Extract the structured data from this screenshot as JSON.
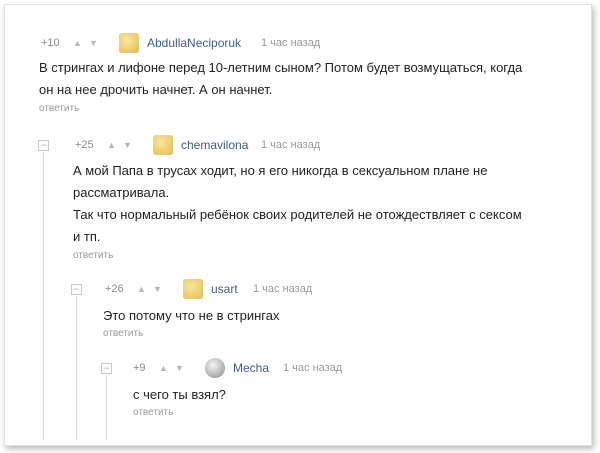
{
  "comments": [
    {
      "rating": "+10",
      "author": "AbdullaNeciporuk",
      "time": "1 час назад",
      "lines": [
        "В стрингах и лифоне перед 10-летним сыном? Потом будет возмущаться, когда",
        "он на нее дрочить начнет. А он начнет."
      ],
      "reply": "ответить"
    },
    {
      "rating": "+25",
      "author": "chemavilona",
      "time": "1 час назад",
      "lines": [
        "А мой Папа в трусах ходит, но я его никогда в сексуальном плане не",
        "рассматривала.",
        "Так что нормальный ребёнок своих родителей не отождествляет с сексом",
        "и тп."
      ],
      "reply": "ответить"
    },
    {
      "rating": "+26",
      "author": "usart",
      "time": "1 час назад",
      "lines": [
        "Это потому что не в стрингах"
      ],
      "reply": "ответить"
    },
    {
      "rating": "+9",
      "author": "Mecha",
      "time": "1 час назад",
      "lines": [
        "с чего ты взял?"
      ],
      "reply": "ответить"
    }
  ],
  "icons": {
    "upvote": "triangle-up-icon",
    "downvote": "triangle-down-icon",
    "collapse": "minus-box-icon"
  },
  "colors": {
    "author": "#3e5c88",
    "muted": "#8a8a8a",
    "thread_line": "#dcdcdc"
  }
}
